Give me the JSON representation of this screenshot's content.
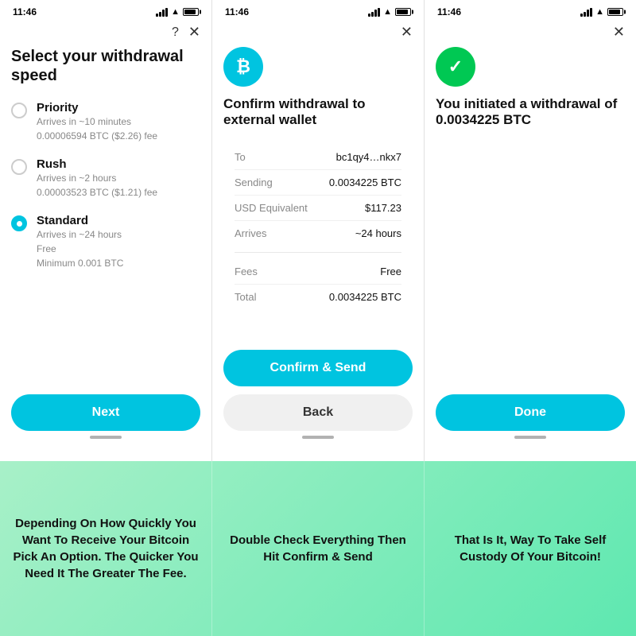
{
  "screens": [
    {
      "id": "screen1",
      "statusBar": {
        "time": "11:46"
      },
      "headerIcons": [
        "?",
        "×"
      ],
      "title": "Select your withdrawal speed",
      "options": [
        {
          "id": "priority",
          "label": "Priority",
          "sub1": "Arrives in ~10 minutes",
          "sub2": "0.00006594 BTC ($2.26) fee",
          "selected": false
        },
        {
          "id": "rush",
          "label": "Rush",
          "sub1": "Arrives in ~2 hours",
          "sub2": "0.00003523 BTC ($1.21) fee",
          "selected": false
        },
        {
          "id": "standard",
          "label": "Standard",
          "sub1": "Arrives in ~24 hours",
          "sub2": "Free",
          "sub3": "Minimum 0.001 BTC",
          "selected": true
        }
      ],
      "nextButton": "Next"
    },
    {
      "id": "screen2",
      "statusBar": {
        "time": "11:46"
      },
      "headerIcons": [
        "×"
      ],
      "iconSymbol": "₿",
      "title": "Confirm withdrawal to external wallet",
      "rows": [
        {
          "label": "To",
          "value": "bc1qy4…nkx7"
        },
        {
          "label": "Sending",
          "value": "0.0034225 BTC"
        },
        {
          "label": "USD Equivalent",
          "value": "$117.23"
        },
        {
          "label": "Arrives",
          "value": "~24 hours"
        }
      ],
      "feeRows": [
        {
          "label": "Fees",
          "value": "Free"
        },
        {
          "label": "Total",
          "value": "0.0034225 BTC"
        }
      ],
      "confirmButton": "Confirm & Send",
      "backButton": "Back"
    },
    {
      "id": "screen3",
      "statusBar": {
        "time": "11:46"
      },
      "headerIcons": [
        "×"
      ],
      "iconSymbol": "✓",
      "title": "You initiated a withdrawal of 0.0034225 BTC",
      "doneButton": "Done"
    }
  ],
  "captions": [
    "Depending On How Quickly You Want To Receive Your Bitcoin Pick An Option. The Quicker You Need It The Greater The Fee.",
    "Double Check Everything Then Hit Confirm & Send",
    "That Is It, Way To Take Self Custody Of Your Bitcoin!"
  ]
}
